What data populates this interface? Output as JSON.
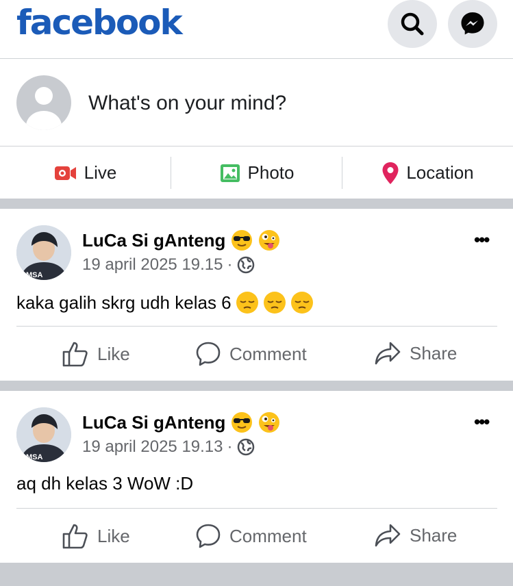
{
  "header": {
    "logo": "facebook"
  },
  "composer": {
    "prompt": "What's on your mind?"
  },
  "actions": {
    "live": "Live",
    "photo": "Photo",
    "location": "Location"
  },
  "colors": {
    "brand": "#1b5bb8",
    "live": "#e4423c",
    "photo": "#45bd62",
    "location": "#e0245e",
    "muted": "#65676b"
  },
  "posts": [
    {
      "author": "LuCa Si gAnteng",
      "timestamp": "19 april 2025 19.15",
      "text": "kaka galih skrg udh kelas 6",
      "like": "Like",
      "comment": "Comment",
      "share": "Share"
    },
    {
      "author": "LuCa Si gAnteng",
      "timestamp": "19 april 2025 19.13",
      "text": "aq dh kelas 3 WoW :D",
      "like": "Like",
      "comment": "Comment",
      "share": "Share"
    }
  ]
}
